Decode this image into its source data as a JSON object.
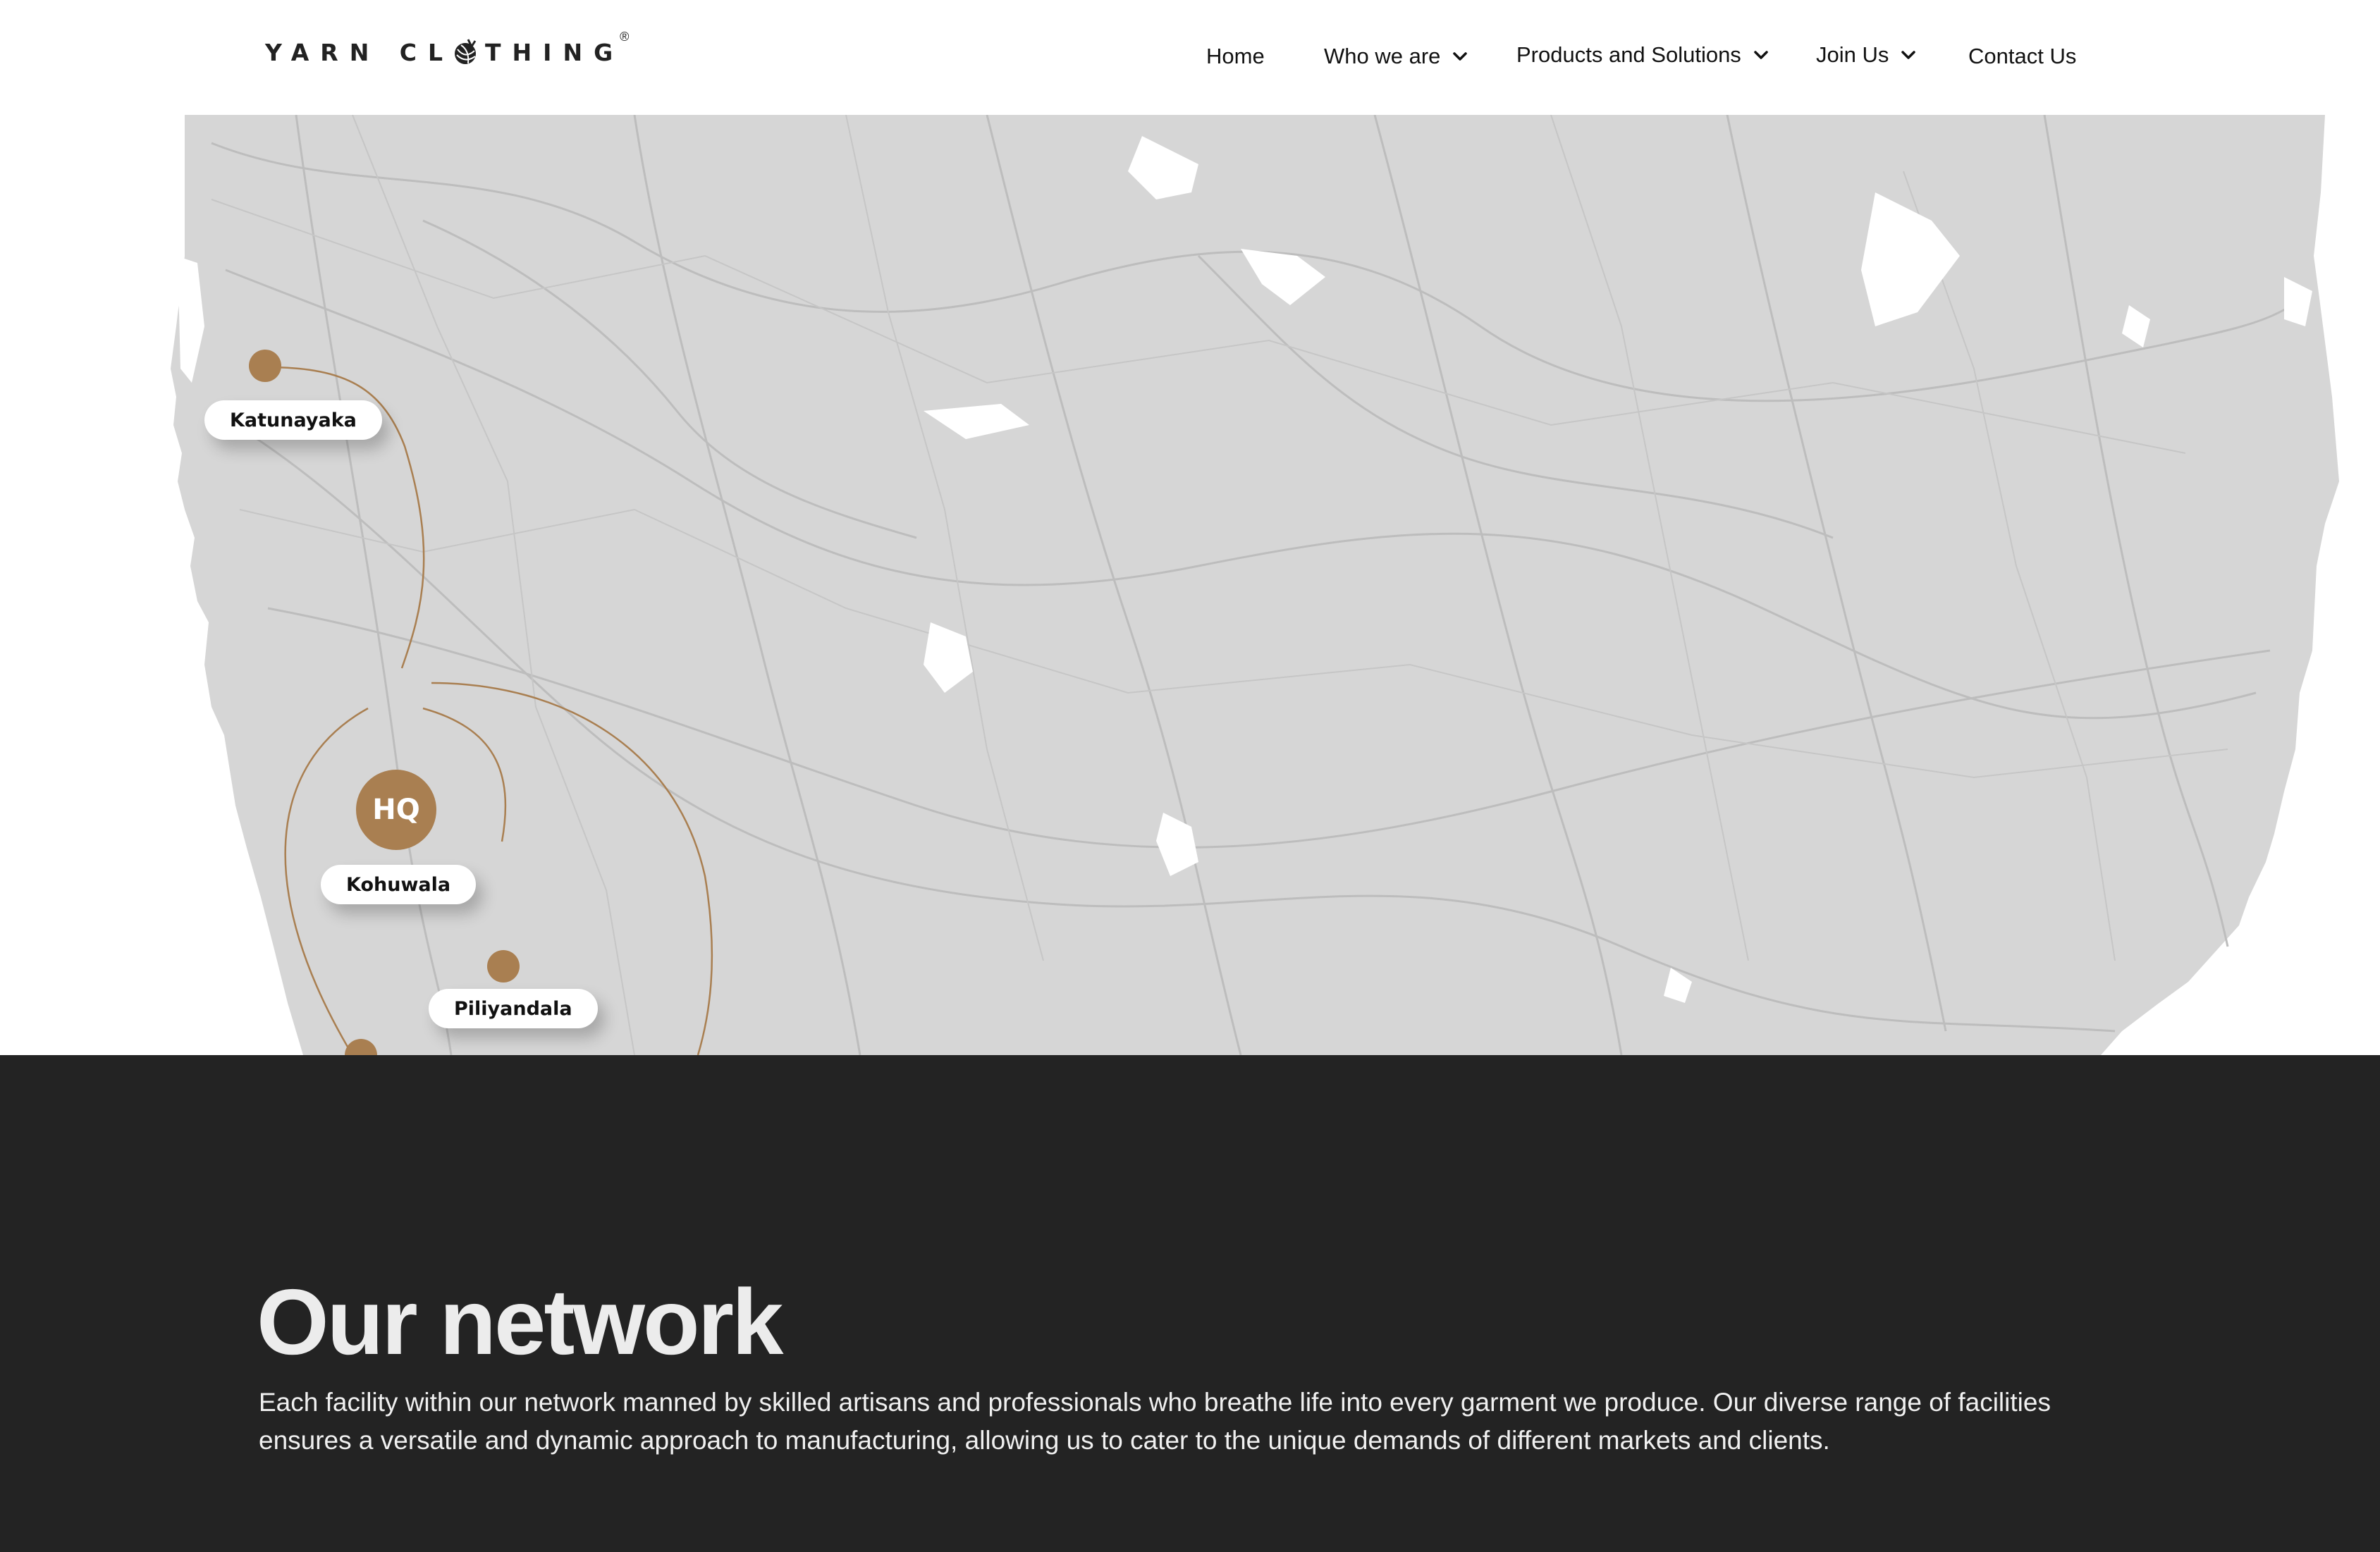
{
  "header": {
    "logo": {
      "text": "YARN CL THING",
      "registered_mark": "®",
      "icon": "yarn-ball-icon"
    },
    "nav": [
      {
        "label": "Home",
        "has_dropdown": false
      },
      {
        "label": "Who we are",
        "has_dropdown": true
      },
      {
        "label": "Products and Solutions",
        "has_dropdown": true
      },
      {
        "label": "Join Us",
        "has_dropdown": true
      },
      {
        "label": "Contact Us",
        "has_dropdown": false
      }
    ]
  },
  "map": {
    "hq_marker": "HQ",
    "locations": [
      {
        "name": "Katunayaka"
      },
      {
        "name": "Kohuwala"
      },
      {
        "name": "Piliyandala"
      }
    ],
    "colors": {
      "land": "#d6d6d6",
      "roads": "#bdbdbd",
      "marker": "#a97f51",
      "route": "#a97f51"
    }
  },
  "network": {
    "title": "Our network",
    "description": "Each facility within our network manned by skilled artisans and professionals who breathe life into every garment we produce. Our diverse range of facilities ensures a versatile and dynamic approach to manufacturing, allowing us to cater to the unique demands of different markets and clients."
  },
  "colors": {
    "dark_section": "#232323",
    "accent": "#a97f51"
  }
}
